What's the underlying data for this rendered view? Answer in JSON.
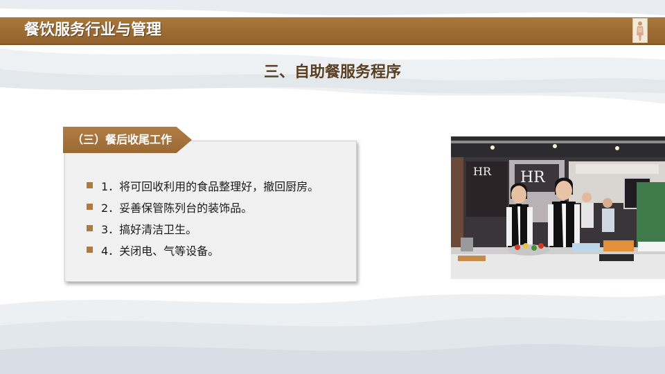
{
  "header": {
    "title": "餐饮服务行业与管理"
  },
  "page": {
    "title": "三、自助餐服务程序"
  },
  "section": {
    "tag_label": "（三）餐后收尾工作",
    "items": [
      "1．将可回收利用的食品整理好，撤回厨房。",
      "2．妥善保管陈列台的装饰品。",
      "3．搞好清洁卫生。",
      "4．关闭电、气等设备。"
    ]
  },
  "photo": {
    "sign_text_1": "HR",
    "sign_text_2": "HR"
  },
  "colors": {
    "header_brown": "#9a6932",
    "bullet_brown": "#b07a3c",
    "title_brown": "#5a3f22",
    "card_bg": "#f1f1f1"
  }
}
